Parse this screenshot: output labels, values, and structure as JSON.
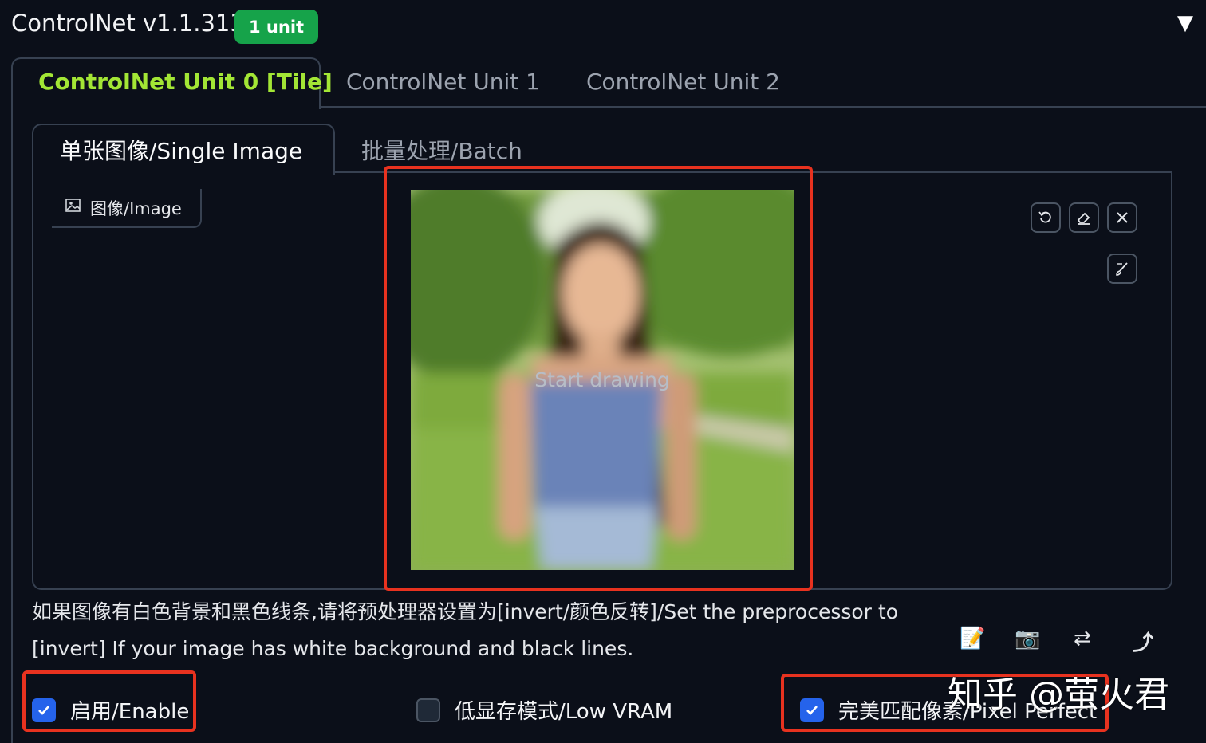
{
  "header": {
    "title": "ControlNet v1.1.313",
    "badge": "1 unit",
    "collapse_glyph": "▼"
  },
  "unit_tabs": [
    {
      "label": "ControlNet Unit 0 [Tile]",
      "active": true
    },
    {
      "label": "ControlNet Unit 1",
      "active": false
    },
    {
      "label": "ControlNet Unit 2",
      "active": false
    }
  ],
  "input_tabs": [
    {
      "label": "单张图像/Single Image",
      "active": true
    },
    {
      "label": "批量处理/Batch",
      "active": false
    }
  ],
  "image_panel": {
    "label": "图像/Image",
    "overlay_text": "Start drawing",
    "controls": [
      "undo-icon",
      "eraser-icon",
      "close-icon",
      "brush-icon"
    ]
  },
  "hint_text": "如果图像有白色背景和黑色线条,请将预处理器设置为[invert/颜色反转]/Set the preprocessor to [invert] If your image has white background and black lines.",
  "tools": {
    "edit": "📝",
    "camera": "📷",
    "swap": "⇄",
    "upload": "⤴"
  },
  "options": [
    {
      "label": "启用/Enable",
      "checked": true
    },
    {
      "label": "低显存模式/Low VRAM",
      "checked": false
    },
    {
      "label": "完美匹配像素/Pixel Perfect",
      "checked": true
    }
  ],
  "watermark": "知乎 @萤火君",
  "colors": {
    "accent_green": "#a3e635",
    "badge_green": "#16a34a",
    "checkbox_blue": "#2563eb",
    "highlight_red": "#e8321f",
    "background": "#0b0f19"
  }
}
